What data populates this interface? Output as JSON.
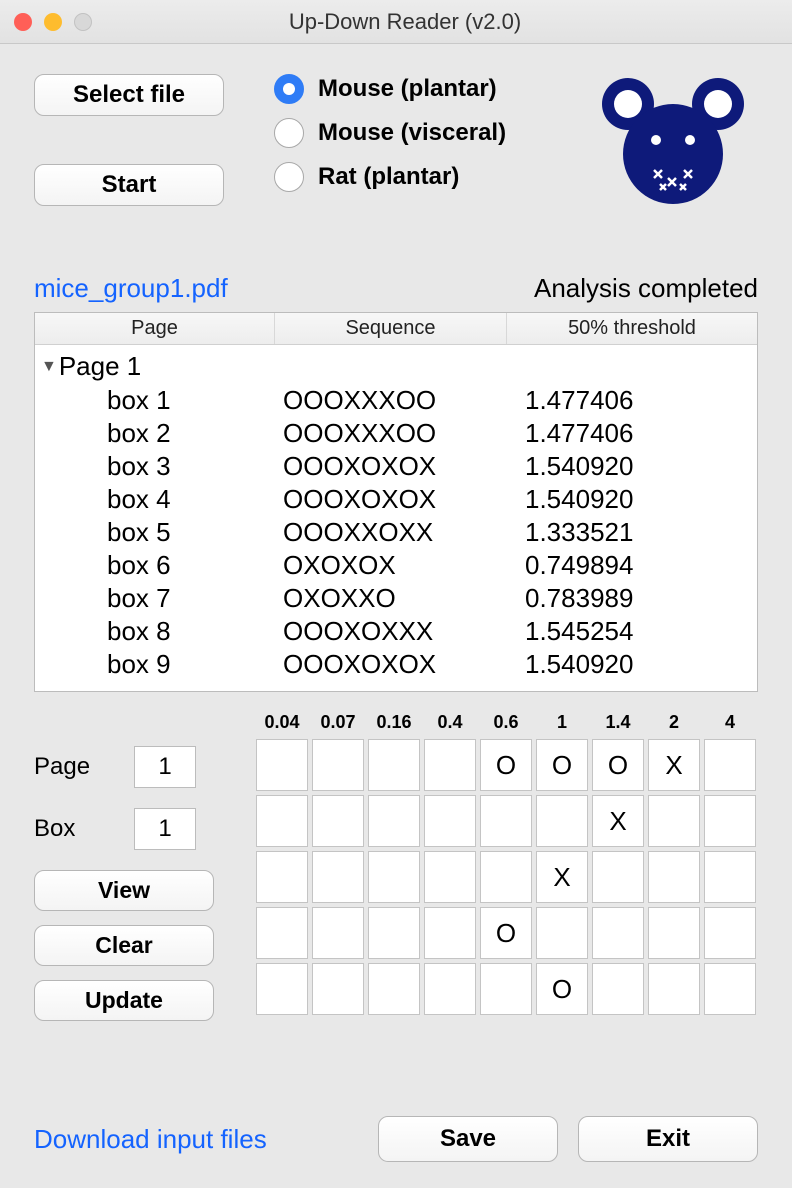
{
  "window": {
    "title": "Up-Down Reader (v2.0)"
  },
  "buttons": {
    "select_file": "Select file",
    "start": "Start",
    "view": "View",
    "clear": "Clear",
    "update": "Update",
    "save": "Save",
    "exit": "Exit"
  },
  "radios": {
    "mouse_plantar": "Mouse (plantar)",
    "mouse_visceral": "Mouse (visceral)",
    "rat_plantar": "Rat (plantar)",
    "selected": "mouse_plantar"
  },
  "file": {
    "name": "mice_group1.pdf",
    "status": "Analysis completed"
  },
  "table": {
    "headers": {
      "page": "Page",
      "sequence": "Sequence",
      "threshold": "50% threshold"
    },
    "group": "Page 1",
    "rows": [
      {
        "page": "box 1",
        "seq": "OOOXXXOO",
        "thr": "1.477406"
      },
      {
        "page": "box 2",
        "seq": "OOOXXXOO",
        "thr": "1.477406"
      },
      {
        "page": "box 3",
        "seq": "OOOXOXOX",
        "thr": "1.540920"
      },
      {
        "page": "box 4",
        "seq": "OOOXOXOX",
        "thr": "1.540920"
      },
      {
        "page": "box 5",
        "seq": "OOOXXOXX",
        "thr": "1.333521"
      },
      {
        "page": "box 6",
        "seq": "OXOXOX",
        "thr": "0.749894"
      },
      {
        "page": "box 7",
        "seq": "OXOXXO",
        "thr": "0.783989"
      },
      {
        "page": "box 8",
        "seq": "OOOXOXXX",
        "thr": "1.545254"
      },
      {
        "page": "box 9",
        "seq": "OOOXOXOX",
        "thr": "1.540920"
      }
    ]
  },
  "inputs": {
    "page_label": "Page",
    "page_value": "1",
    "box_label": "Box",
    "box_value": "1"
  },
  "grid": {
    "headers": [
      "0.04",
      "0.07",
      "0.16",
      "0.4",
      "0.6",
      "1",
      "1.4",
      "2",
      "4"
    ],
    "cells": [
      [
        "",
        "",
        "",
        "",
        "O",
        "O",
        "O",
        "X",
        ""
      ],
      [
        "",
        "",
        "",
        "",
        "",
        "",
        "X",
        "",
        ""
      ],
      [
        "",
        "",
        "",
        "",
        "",
        "X",
        "",
        "",
        ""
      ],
      [
        "",
        "",
        "",
        "",
        "O",
        "",
        "",
        "",
        ""
      ],
      [
        "",
        "",
        "",
        "",
        "",
        "O",
        "",
        "",
        ""
      ]
    ]
  },
  "footer": {
    "download": "Download input files"
  }
}
